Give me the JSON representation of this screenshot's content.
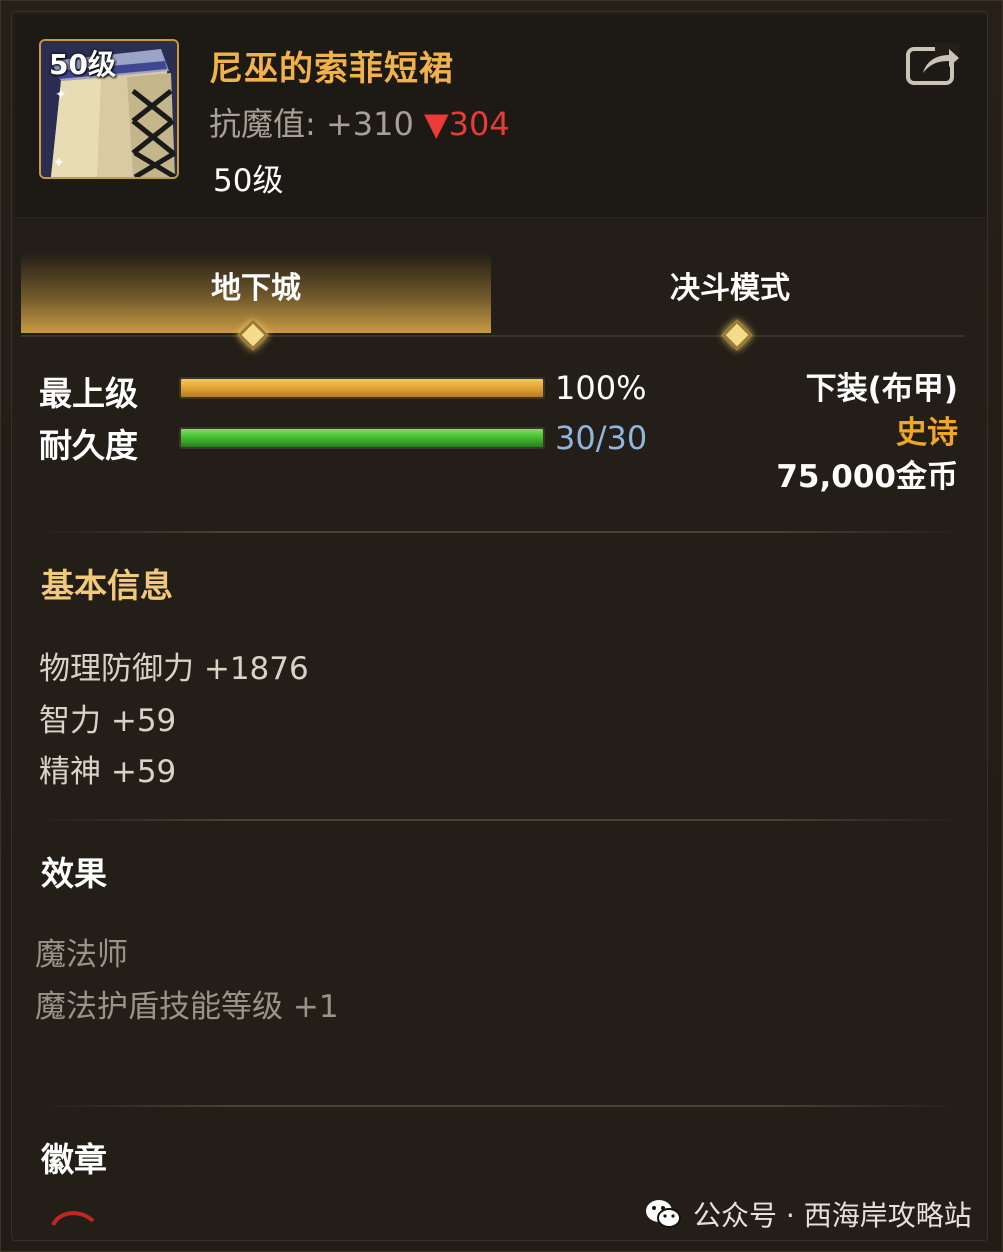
{
  "item": {
    "level_badge": "50级",
    "name": "尼巫的索菲短裙",
    "stat_label": "抗魔值:",
    "stat_value": "+310",
    "stat_diff": "▼304",
    "level": "50级"
  },
  "tabs": [
    {
      "label": "地下城",
      "active": true
    },
    {
      "label": "决斗模式",
      "active": false
    }
  ],
  "bars": {
    "grade": {
      "label": "最上级",
      "value_text": "100%",
      "fill": 1.0
    },
    "durability": {
      "label": "耐久度",
      "value_text": "30/30",
      "fill": 1.0
    }
  },
  "right_info": {
    "slot": "下装(布甲)",
    "rarity": "史诗",
    "price": "75,000金币"
  },
  "basic_info": {
    "title": "基本信息",
    "lines": [
      "物理防御力 +1876",
      "智力 +59",
      "精神 +59"
    ]
  },
  "effect": {
    "title": "效果",
    "lines": [
      "魔法师",
      "魔法护盾技能等级 +1"
    ]
  },
  "emblem": {
    "title": "徽章"
  },
  "watermark": {
    "text": "公众号 · 西海岸攻略站"
  },
  "colors": {
    "item_name": "#f2b24b",
    "stat_down": "#ea3b36",
    "section_title": "#f0c97a",
    "rarity_epic": "#f0a728",
    "durability_value": "#8fb6df"
  },
  "icons": {
    "item": "skirt-icon",
    "share": "share-icon",
    "tab_marker": "diamond-icon",
    "watermark": "wechat-icon"
  }
}
